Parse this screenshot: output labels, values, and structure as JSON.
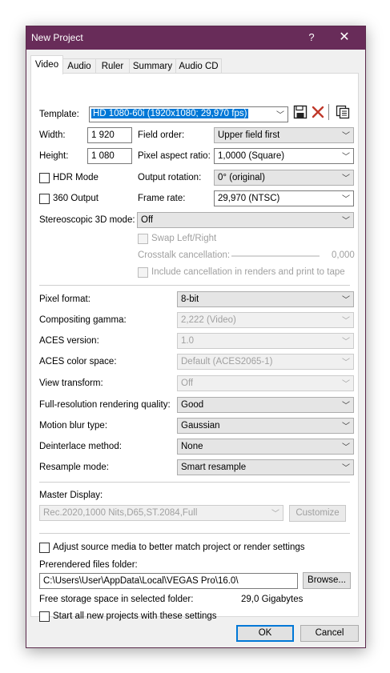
{
  "window": {
    "title": "New Project",
    "help": "?",
    "close": "✕"
  },
  "tabs": [
    "Video",
    "Audio",
    "Ruler",
    "Summary",
    "Audio CD"
  ],
  "template": {
    "label": "Template:",
    "value": "HD 1080-60i (1920x1080; 29,970 fps)"
  },
  "width": {
    "label": "Width:",
    "value": "1 920"
  },
  "height": {
    "label": "Height:",
    "value": "1 080"
  },
  "field_order": {
    "label": "Field order:",
    "value": "Upper field first"
  },
  "pixel_aspect": {
    "label": "Pixel aspect ratio:",
    "value": "1,0000 (Square)"
  },
  "hdr_mode": {
    "label": "HDR Mode"
  },
  "output_rotation": {
    "label": "Output rotation:",
    "value": "0° (original)"
  },
  "output_360": {
    "label": "360 Output"
  },
  "frame_rate": {
    "label": "Frame rate:",
    "value": "29,970 (NTSC)"
  },
  "stereo3d": {
    "label": "Stereoscopic 3D mode:",
    "value": "Off"
  },
  "swap": {
    "label": "Swap Left/Right"
  },
  "crosstalk": {
    "label": "Crosstalk cancellation:",
    "value": "0,000"
  },
  "include_cancel": {
    "label": "Include cancellation in renders and print to tape"
  },
  "pixel_format": {
    "label": "Pixel format:",
    "value": "8-bit"
  },
  "compositing_gamma": {
    "label": "Compositing gamma:",
    "value": "2,222 (Video)"
  },
  "aces_version": {
    "label": "ACES version:",
    "value": "1.0"
  },
  "aces_color_space": {
    "label": "ACES color space:",
    "value": "Default (ACES2065-1)"
  },
  "view_transform": {
    "label": "View transform:",
    "value": "Off"
  },
  "render_quality": {
    "label": "Full-resolution rendering quality:",
    "value": "Good"
  },
  "motion_blur": {
    "label": "Motion blur type:",
    "value": "Gaussian"
  },
  "deinterlace": {
    "label": "Deinterlace method:",
    "value": "None"
  },
  "resample": {
    "label": "Resample mode:",
    "value": "Smart resample"
  },
  "master_display": {
    "label": "Master Display:",
    "value": "Rec.2020,1000 Nits,D65,ST.2084,Full",
    "customize": "Customize"
  },
  "adjust_source": {
    "label": "Adjust source media to better match project or render settings"
  },
  "prerendered": {
    "label": "Prerendered files folder:",
    "value": "C:\\Users\\User\\AppData\\Local\\VEGAS Pro\\16.0\\",
    "browse": "Browse..."
  },
  "free_storage": {
    "label": "Free storage space in selected folder:",
    "value": "29,0 Gigabytes"
  },
  "start_all": {
    "label": "Start all new projects with these settings"
  },
  "buttons": {
    "ok": "OK",
    "cancel": "Cancel"
  },
  "colors": {
    "titlebar": "#682c59",
    "selection": "#0078d7",
    "default_button_border": "#0078d7"
  },
  "icons": [
    "save-icon",
    "delete-icon",
    "copy-icon",
    "chevron-down-icon"
  ]
}
